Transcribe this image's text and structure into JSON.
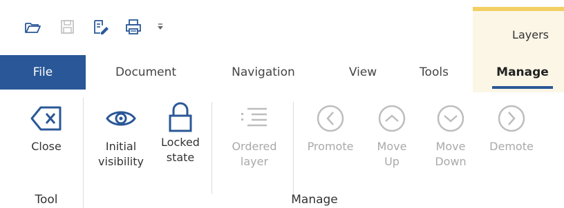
{
  "quick_access": {
    "icons": [
      "open-folder-icon",
      "save-icon",
      "edit-document-icon",
      "print-icon",
      "customize-dropdown-icon"
    ]
  },
  "contextual_tab_group": {
    "label": "Layers",
    "accent": "#f3cf63",
    "background": "#fbf6e6"
  },
  "tabs": [
    {
      "label": "File"
    },
    {
      "label": "Document"
    },
    {
      "label": "Navigation"
    },
    {
      "label": "View"
    },
    {
      "label": "Tools"
    },
    {
      "label": "Manage"
    }
  ],
  "colors": {
    "brand": "#2a5797",
    "icon_active": "#2a5797",
    "icon_disabled": "#bdbdbd"
  },
  "ribbon": {
    "tool_group": {
      "label": "Tool",
      "buttons": [
        {
          "label": "Close",
          "icon": "backspace-x-icon",
          "enabled": true
        }
      ]
    },
    "manage_group": {
      "label": "Manage",
      "buttons": [
        {
          "label": "Initial\nvisibility",
          "icon": "eye-icon",
          "enabled": true
        },
        {
          "label": "Locked\nstate",
          "icon": "lock-icon",
          "enabled": true
        },
        {
          "label": "Ordered\nlayer",
          "icon": "ordered-list-icon",
          "enabled": false
        },
        {
          "label": "Promote",
          "icon": "chevron-left-circle-icon",
          "enabled": false
        },
        {
          "label": "Move\nUp",
          "icon": "chevron-up-circle-icon",
          "enabled": false
        },
        {
          "label": "Move\nDown",
          "icon": "chevron-down-circle-icon",
          "enabled": false
        },
        {
          "label": "Demote",
          "icon": "chevron-right-circle-icon",
          "enabled": false
        }
      ]
    }
  }
}
